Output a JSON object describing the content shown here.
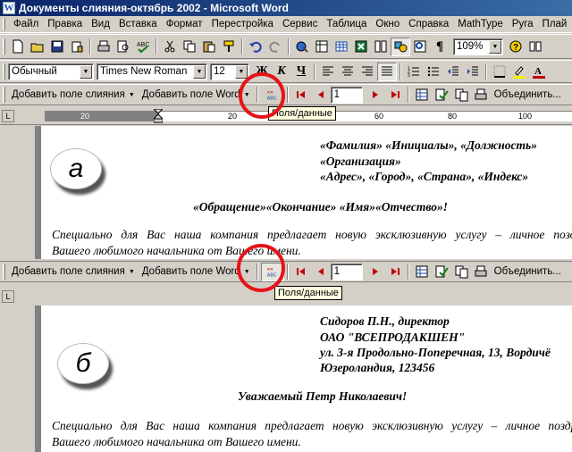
{
  "window": {
    "title": "Документы слияния-октябрь 2002 - Microsoft Word",
    "icon": "word-app-icon"
  },
  "menu": [
    "Файл",
    "Правка",
    "Вид",
    "Вставка",
    "Формат",
    "Перестройка",
    "Сервис",
    "Таблица",
    "Окно",
    "Справка",
    "MathType",
    "Руга",
    "Плай",
    "Ac"
  ],
  "standard_toolbar": {
    "zoom": "109%"
  },
  "formatting_toolbar": {
    "style": "Обычный",
    "font": "Times New Roman",
    "size": "12"
  },
  "mail_merge_toolbar": {
    "insert_merge_field": "Добавить поле слияния",
    "insert_word_field": "Добавить поле Word",
    "view_merged_icon": "abc-field-data-icon",
    "record_number": "1",
    "merge_to_label": "Объединить..."
  },
  "ruler": {
    "numbers": [
      "20",
      "20",
      "40",
      "60",
      "80",
      "100"
    ]
  },
  "panel_a": {
    "badge": "а",
    "tooltip": "Поля/данные",
    "addr_line1": "«Фамилия» «Инициалы», «Должность»",
    "addr_line2": "«Организация»",
    "addr_line3": "«Адрес», «Город», «Страна», «Индекс»",
    "greeting": "«Обращение»«Окончание» «Имя»«Отчество»!",
    "body_line1": "Специально для Вас наша компания предлагает новую эксклюзивную услугу – личное поздра",
    "body_line2": "Вашего любимого начальника от Вашего имени."
  },
  "panel_b": {
    "badge": "б",
    "tooltip": "Поля/данные",
    "addr_line1": "Сидоров П.Н., директор",
    "addr_line2": "ОАО \"ВСЕПРОДАКШЕН\"",
    "addr_line3": "ул. 3-я Продольно-Поперечная, 13, Вордичё",
    "addr_line4": "Юзероландия, 123456",
    "greeting": "Уважаемый Петр Николаевич!",
    "body_line1": "Специально для Вас наша компания предлагает новую эксклюзивную услугу – личное поздрав",
    "body_line2": "Вашего любимого начальника от Вашего имени."
  },
  "colors": {
    "title_bar": "#0a246a",
    "highlight_ring": "#e5141a",
    "tooltip_bg": "#ffffe1"
  }
}
